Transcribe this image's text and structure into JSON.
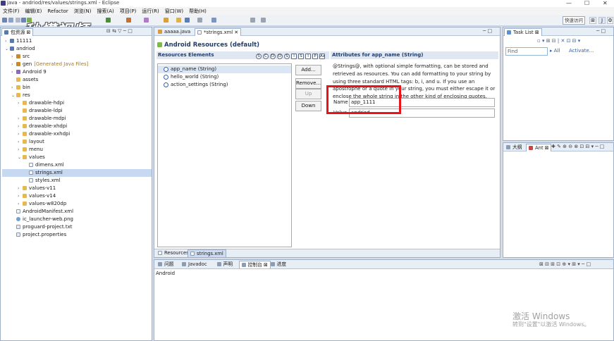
{
  "window": {
    "title": "java - andriod/res/values/strings.xml - Eclipse"
  },
  "menu": [
    "文件(F)",
    "编辑(E)",
    "Refactor",
    "浏览(N)",
    "搜索(A)",
    "项目(P)",
    "运行(R)",
    "窗口(W)",
    "帮助(H)"
  ],
  "quick_access": "快速访问",
  "logo_text": "秒懂视频",
  "left_panel": {
    "tab_label": "包资源",
    "tree": [
      {
        "label": "11111",
        "indent": 0,
        "arrow": ">",
        "icon": "proj"
      },
      {
        "label": "andriod",
        "indent": 0,
        "arrow": "v",
        "icon": "proj"
      },
      {
        "label": "src",
        "indent": 1,
        "arrow": ">",
        "icon": "pkg"
      },
      {
        "label": "gen",
        "indent": 1,
        "arrow": ">",
        "icon": "pkg",
        "suffix": "[Generated Java Files]"
      },
      {
        "label": "Android 9",
        "indent": 1,
        "arrow": ">",
        "icon": "lib"
      },
      {
        "label": "assets",
        "indent": 1,
        "arrow": "",
        "icon": "folder"
      },
      {
        "label": "bin",
        "indent": 1,
        "arrow": ">",
        "icon": "folder"
      },
      {
        "label": "res",
        "indent": 1,
        "arrow": "v",
        "icon": "folder"
      },
      {
        "label": "drawable-hdpi",
        "indent": 2,
        "arrow": ">",
        "icon": "folder"
      },
      {
        "label": "drawable-ldpi",
        "indent": 2,
        "arrow": "",
        "icon": "folder"
      },
      {
        "label": "drawable-mdpi",
        "indent": 2,
        "arrow": ">",
        "icon": "folder"
      },
      {
        "label": "drawable-xhdpi",
        "indent": 2,
        "arrow": ">",
        "icon": "folder"
      },
      {
        "label": "drawable-xxhdpi",
        "indent": 2,
        "arrow": ">",
        "icon": "folder"
      },
      {
        "label": "layout",
        "indent": 2,
        "arrow": ">",
        "icon": "folder"
      },
      {
        "label": "menu",
        "indent": 2,
        "arrow": ">",
        "icon": "folder"
      },
      {
        "label": "values",
        "indent": 2,
        "arrow": "v",
        "icon": "folder"
      },
      {
        "label": "dimens.xml",
        "indent": 3,
        "arrow": "",
        "icon": "xml"
      },
      {
        "label": "strings.xml",
        "indent": 3,
        "arrow": "",
        "icon": "xml",
        "selected": true
      },
      {
        "label": "styles.xml",
        "indent": 3,
        "arrow": "",
        "icon": "xml"
      },
      {
        "label": "values-v11",
        "indent": 2,
        "arrow": ">",
        "icon": "folder"
      },
      {
        "label": "values-v14",
        "indent": 2,
        "arrow": ">",
        "icon": "folder"
      },
      {
        "label": "values-w820dp",
        "indent": 2,
        "arrow": ">",
        "icon": "folder"
      },
      {
        "label": "AndroidManifest.xml",
        "indent": 1,
        "arrow": "",
        "icon": "xml"
      },
      {
        "label": "ic_launcher-web.png",
        "indent": 1,
        "arrow": "",
        "icon": "img"
      },
      {
        "label": "proguard-project.txt",
        "indent": 1,
        "arrow": "",
        "icon": "file"
      },
      {
        "label": "project.properties",
        "indent": 1,
        "arrow": "",
        "icon": "file"
      }
    ]
  },
  "editor": {
    "tabs": [
      "aaaaa.java",
      "*strings.xml"
    ],
    "title": "Android Resources (default)",
    "resources_header": "Resources Elements",
    "resource_items": [
      "app_name (String)",
      "hello_world (String)",
      "action_settings (String)"
    ],
    "buttons": {
      "add": "Add...",
      "remove": "Remove...",
      "up": "Up",
      "down": "Down"
    },
    "type_icons": [
      "S",
      "C",
      "D",
      "D",
      "S",
      "I",
      "S",
      "I",
      "P",
      "Az"
    ],
    "attributes_header": "Attributes for app_name (String)",
    "attributes_help": "@Strings@, with optional simple formatting, can be stored and retrieved as resources. You can add formatting to your string by using three standard HTML tags: b, i, and u. If you use an apostrophe or a quote in your string, you must either escape it or enclose the whole string in the other kind of enclosing quotes.",
    "name_label": "Name",
    "name_value": "app_1111",
    "value_label": "Value",
    "value_value": "andriod",
    "bottom_tabs": [
      "Resources",
      "strings.xml"
    ]
  },
  "right_panel": {
    "tab_label": "Task List",
    "find_placeholder": "Find",
    "all_label": "All",
    "activate_label": "Activate...",
    "outline_tabs": [
      "大纲",
      "Ant"
    ]
  },
  "console": {
    "tabs": [
      "问题",
      "Javadoc",
      "声明",
      "控制台",
      "进度"
    ],
    "active_tab": "控制台",
    "content": "Android"
  },
  "watermark": {
    "line1": "激活 Windows",
    "line2": "转到\"设置\"以激活 Windows。"
  },
  "colors": {
    "accent": "#3a62a8",
    "highlight": "#e8141a",
    "selection": "#c6d9f0"
  }
}
